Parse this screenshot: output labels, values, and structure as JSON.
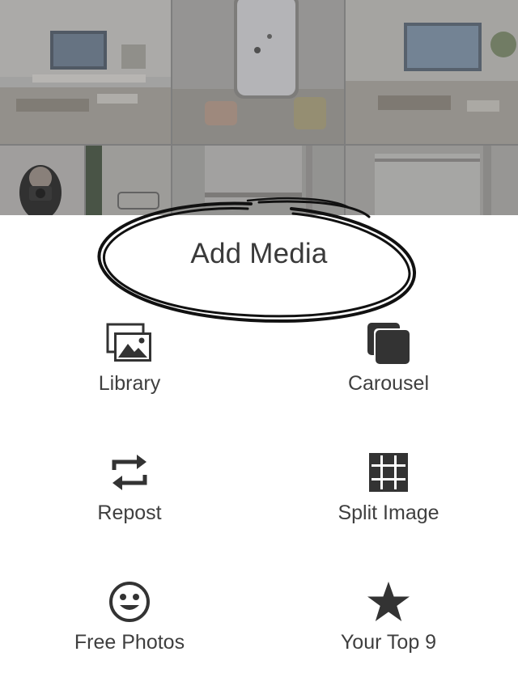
{
  "sheet": {
    "title": "Add Media"
  },
  "options": {
    "library": {
      "label": "Library",
      "icon": "photo-library-icon"
    },
    "carousel": {
      "label": "Carousel",
      "icon": "carousel-stack-icon"
    },
    "repost": {
      "label": "Repost",
      "icon": "repost-arrows-icon"
    },
    "split_image": {
      "label": "Split Image",
      "icon": "grid-split-icon"
    },
    "free_photos": {
      "label": "Free Photos",
      "icon": "smiley-face-icon"
    },
    "your_top_9": {
      "label": "Your Top 9",
      "icon": "star-icon"
    }
  },
  "photo_grid": {
    "thumbnails": [
      "desk-setup-photo",
      "phone-mockup-photo",
      "desk-setup-photo-2",
      "mirror-selfie-photo",
      "glass-object-photo",
      "window-photo",
      "window-photo-2"
    ]
  },
  "colors": {
    "text": "#3f3f3f",
    "icon": "#333333",
    "overlay": "#8d8d8d",
    "sheet_bg": "#ffffff"
  }
}
